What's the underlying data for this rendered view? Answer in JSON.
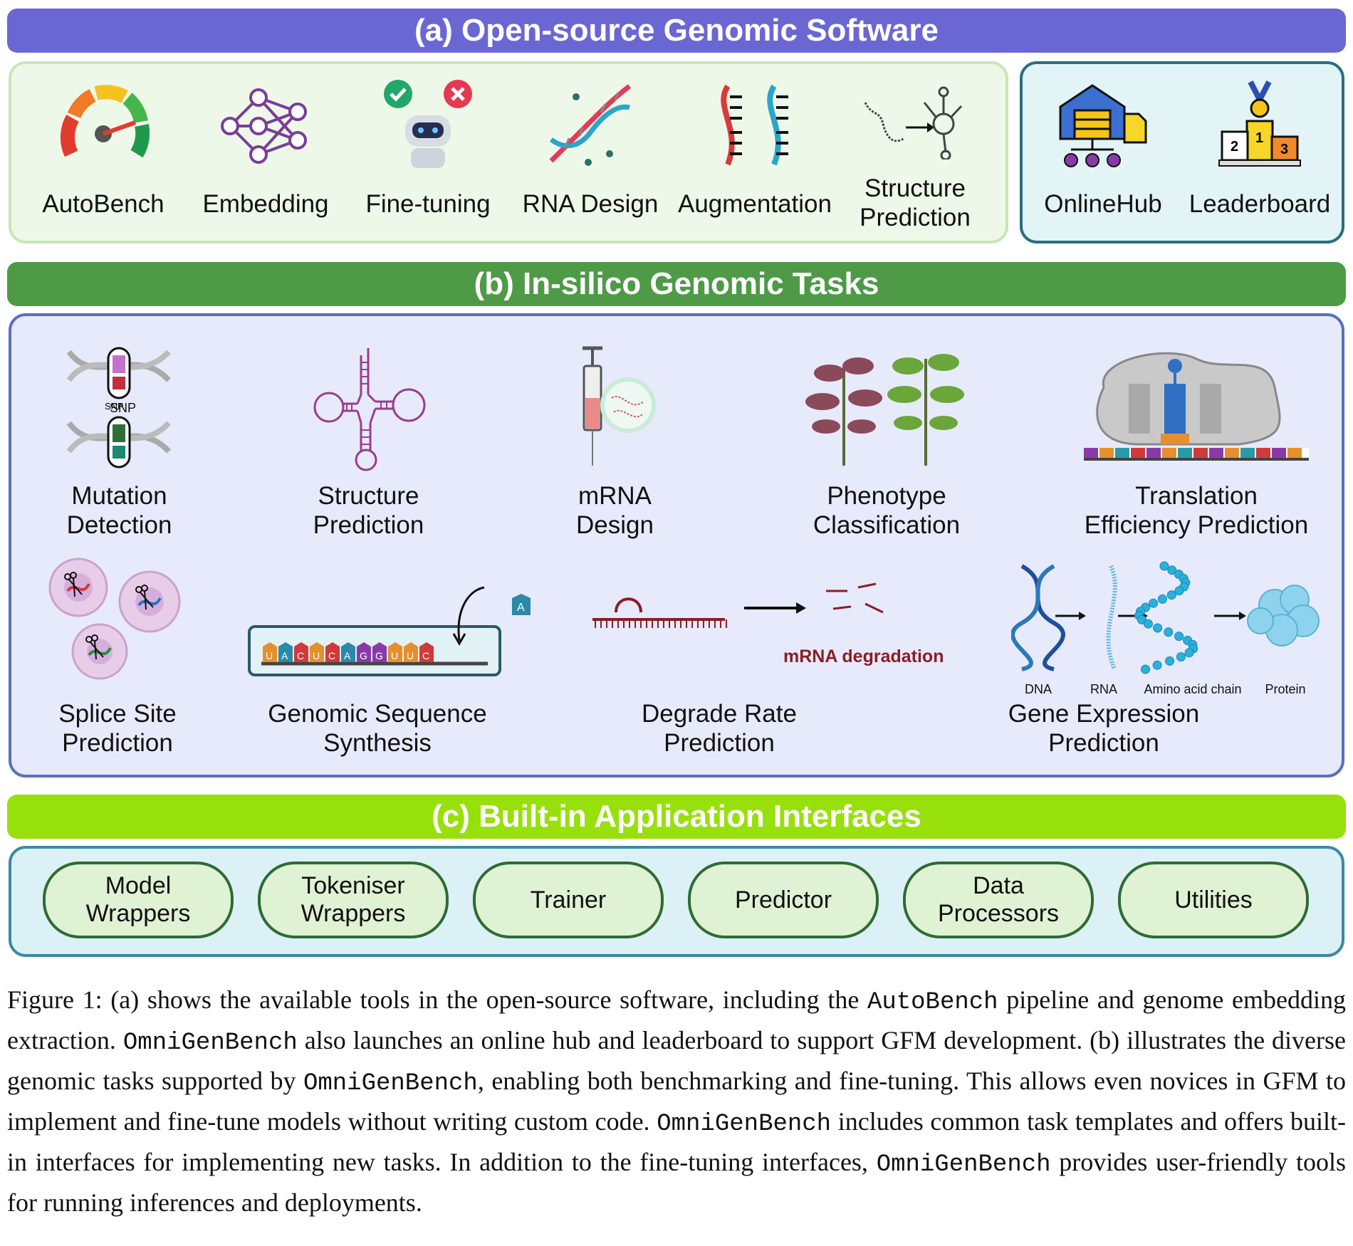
{
  "sections": {
    "a_title": "(a) Open-source Genomic Software",
    "b_title": "(b) In-silico Genomic Tasks",
    "c_title": "(c) Built-in Application Interfaces"
  },
  "colors": {
    "banner_a": "#6a67d3",
    "banner_b": "#4e9a47",
    "banner_c": "#98e00c",
    "panel_a_fill": "#eef8e9",
    "panel_a_border": "#c8e6b8",
    "panel_a2_fill": "#e3f4f6",
    "panel_a2_border": "#2a6e80",
    "panel_b_fill": "#e7eafb",
    "panel_b_border": "#5a6fc0",
    "panel_c_fill": "#dcf1f5",
    "panel_c_border": "#3b8aa3"
  },
  "software_tools": [
    {
      "label": "AutoBench",
      "icon": "speedometer-icon"
    },
    {
      "label": "Embedding",
      "icon": "neural-network-icon"
    },
    {
      "label": "Fine-tuning",
      "icon": "robot-icon"
    },
    {
      "label": "RNA Design",
      "icon": "dna-helix-icon"
    },
    {
      "label": "Augmentation",
      "icon": "rna-strands-icon"
    },
    {
      "label": "Structure\nPrediction",
      "icon": "rna-folding-icon"
    }
  ],
  "hub_tools": [
    {
      "label": "OnlineHub",
      "icon": "warehouse-hub-icon"
    },
    {
      "label": "Leaderboard",
      "icon": "podium-medal-icon"
    }
  ],
  "tasks_row1": [
    {
      "label": "Mutation\nDetection",
      "icon": "snp-dna-icon"
    },
    {
      "label": "Structure\nPrediction",
      "icon": "rna-secondary-structure-icon"
    },
    {
      "label": "mRNA\nDesign",
      "icon": "syringe-icon"
    },
    {
      "label": "Phenotype\nClassification",
      "icon": "plants-icon"
    },
    {
      "label": "Translation\nEfficiency Prediction",
      "icon": "ribosome-icon"
    }
  ],
  "tasks_row2": [
    {
      "label": "Splice Site\nPrediction",
      "icon": "cells-scissors-icon"
    },
    {
      "label": "Genomic Sequence\nSynthesis",
      "icon": "sequence-synthesis-icon"
    },
    {
      "label": "Degrade Rate\nPrediction",
      "icon": "mrna-degradation-icon"
    },
    {
      "label": "Gene Expression\nPrediction",
      "icon": "central-dogma-icon"
    }
  ],
  "snp_label": "SNP",
  "sequence_letters": [
    "U",
    "A",
    "C",
    "U",
    "C",
    "A",
    "G",
    "G",
    "U",
    "U",
    "C"
  ],
  "sequence_extra_letter": "A",
  "degradation_label": "mRNA degradation",
  "dogma_labels": [
    "DNA",
    "RNA",
    "Amino acid chain",
    "Protein"
  ],
  "interfaces": [
    "Model\nWrappers",
    "Tokeniser\nWrappers",
    "Trainer",
    "Predictor",
    "Data\nProcessors",
    "Utilities"
  ],
  "caption": {
    "p1": "Figure 1: (a) shows the available tools in the open-source software, including the ",
    "m1": "AutoBench",
    "p2": " pipeline and genome embedding extraction. ",
    "m2": "OmniGenBench",
    "p3": " also launches an online hub and leaderboard to support GFM development. (b) illustrates the diverse genomic tasks supported by ",
    "m3": "OmniGenBench",
    "p4": ", enabling both benchmarking and fine-tuning. This allows even novices in GFM to implement and fine-tune models without writing custom code. ",
    "m4": "OmniGenBench",
    "p5": " includes common task templates and offers built-in interfaces for implementing new tasks. In addition to the fine-tuning interfaces, ",
    "m5": "OmniGenBench",
    "p6": " provides user-friendly tools for running inferences and deployments."
  }
}
